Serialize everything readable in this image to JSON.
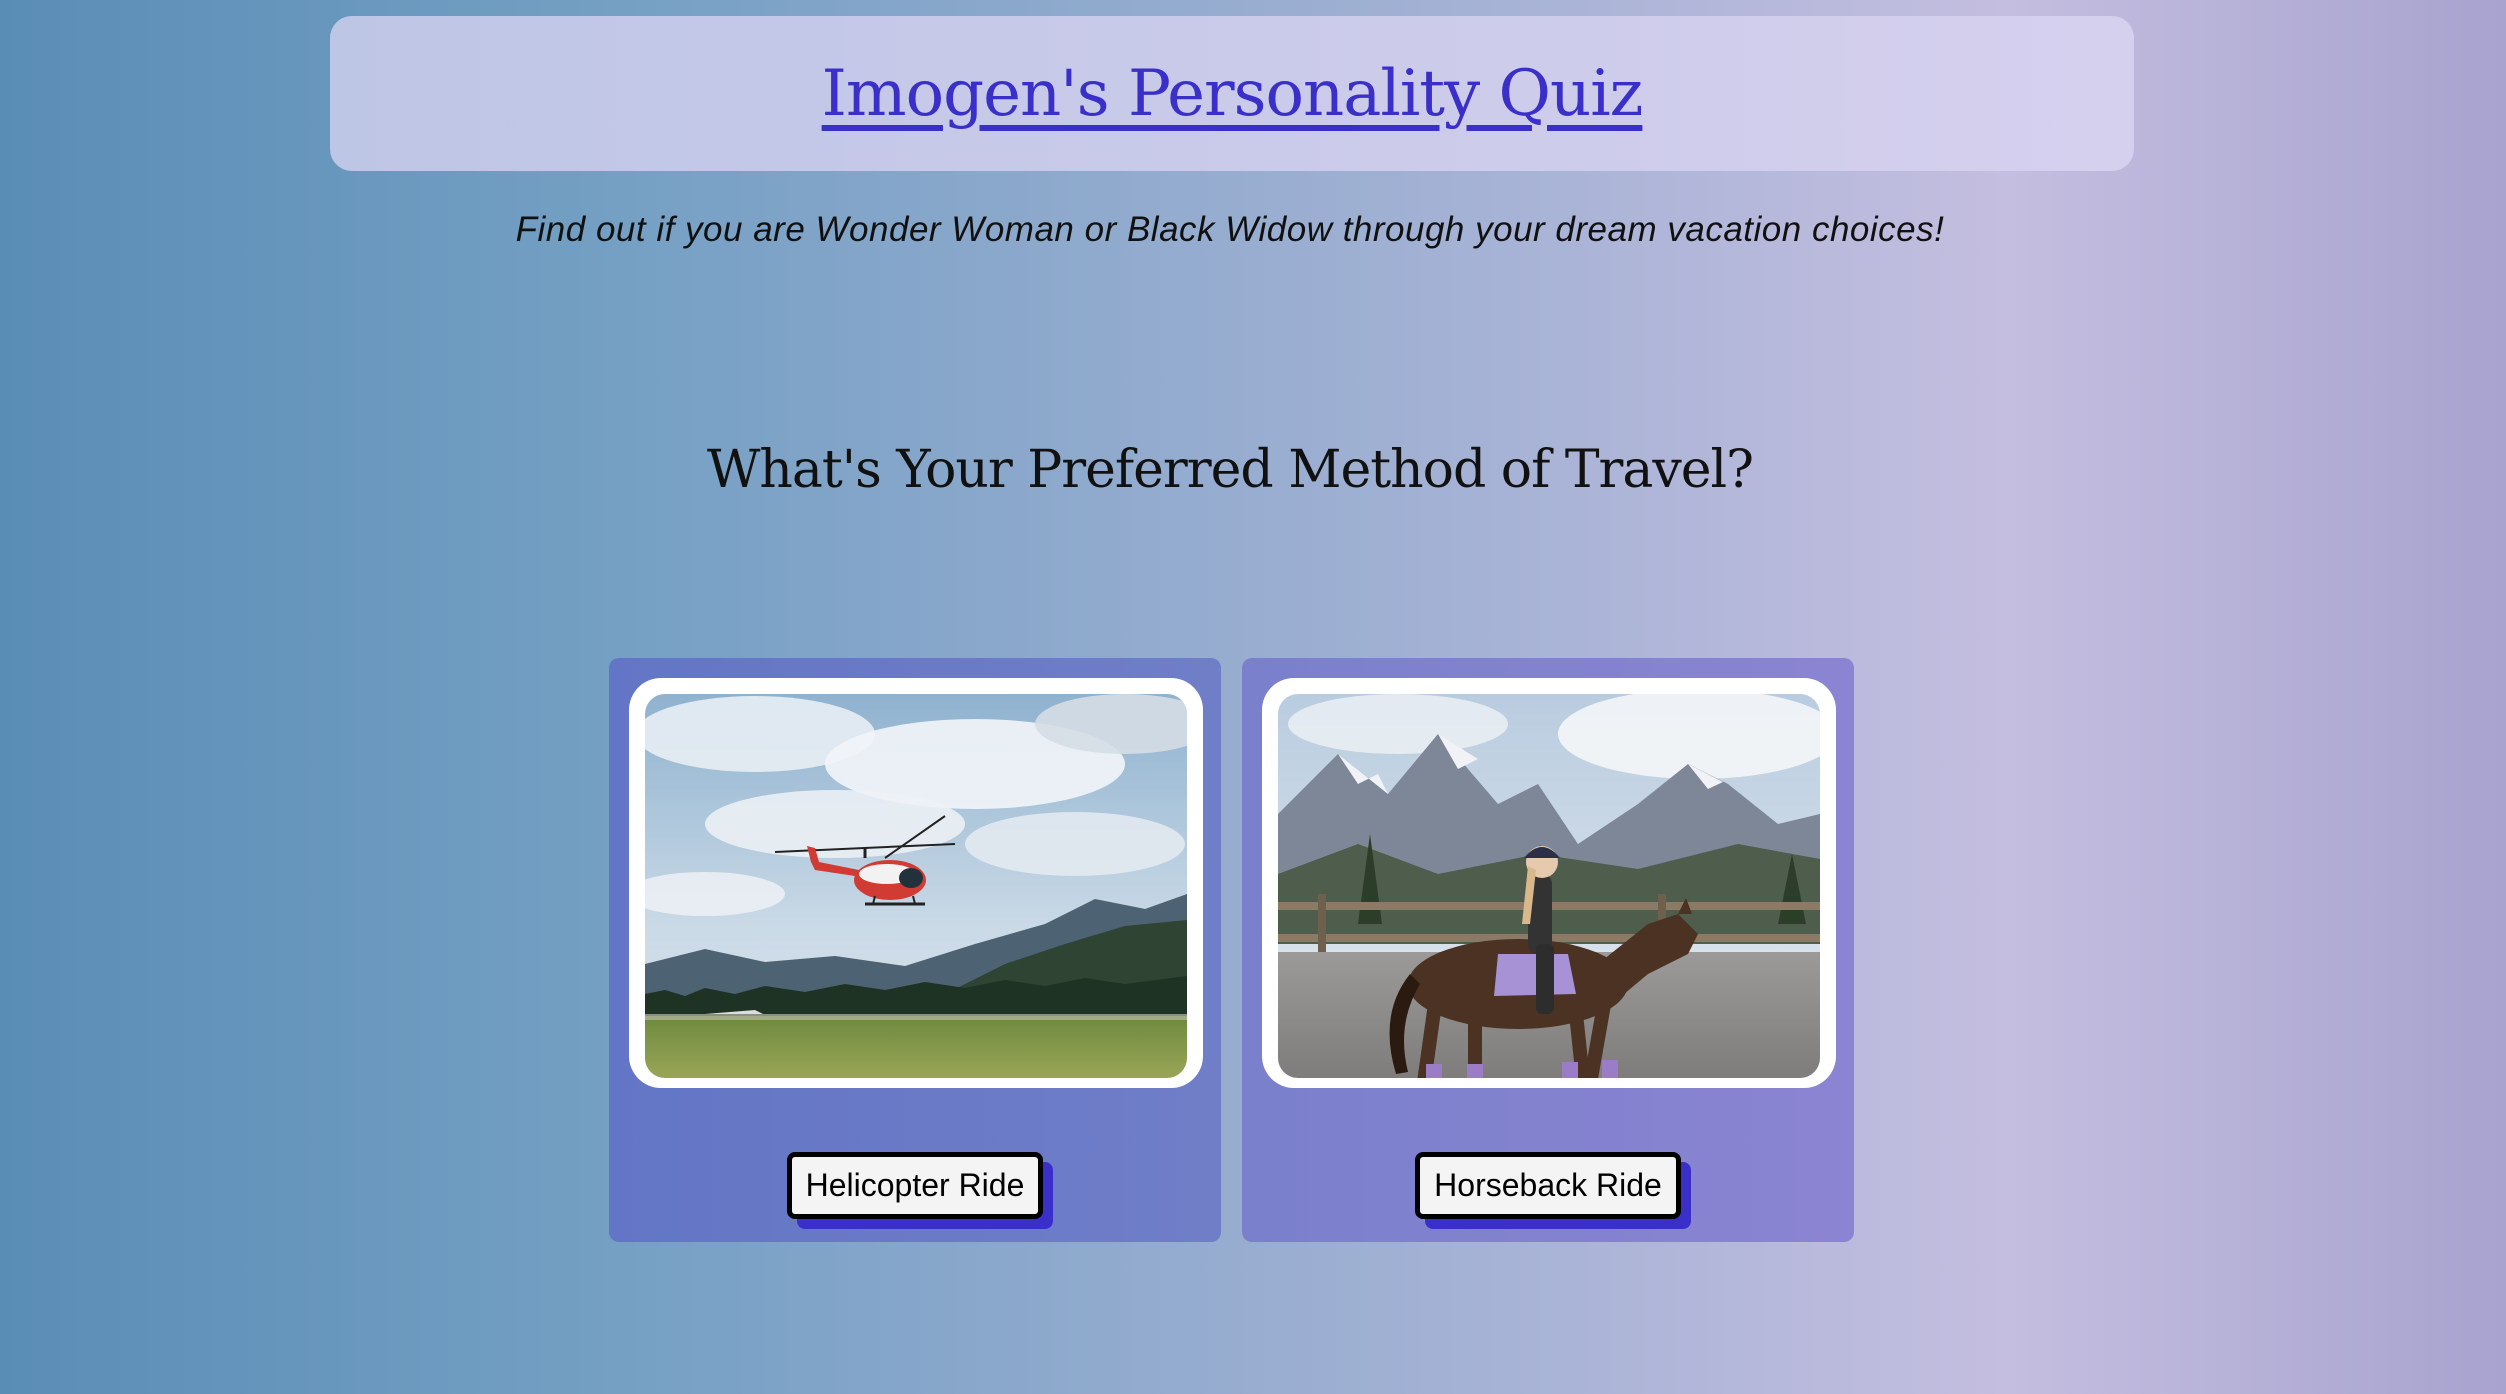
{
  "header": {
    "title": "Imogen's Personality Quiz"
  },
  "intro": {
    "subtitle": "Find out if you are Wonder Woman or Black Widow through your dream vacation choices!"
  },
  "quiz": {
    "question": "What's Your Preferred Method of Travel?",
    "options": [
      {
        "label": "Helicopter Ride",
        "image": "helicopter-photo"
      },
      {
        "label": "Horseback Ride",
        "image": "horse-rider-photo"
      }
    ]
  },
  "colors": {
    "accent": "#3b2fc9",
    "title_link": "#3b2fc9",
    "banner_bg": "#c8c9ea",
    "card_left": "#6a7ac7",
    "card_right": "#8482cf"
  }
}
